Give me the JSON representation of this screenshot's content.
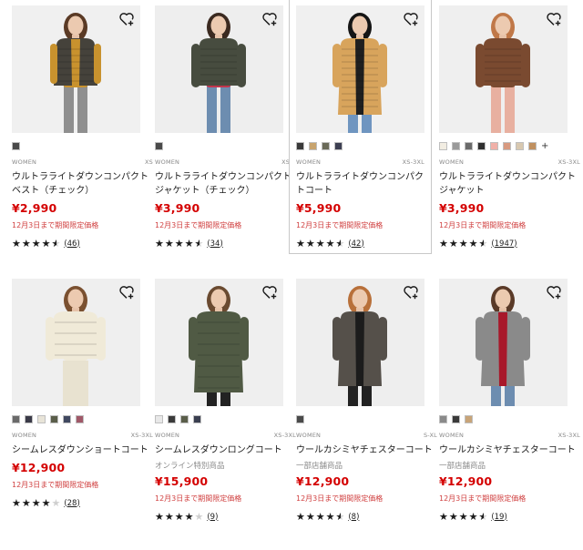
{
  "products": [
    {
      "category": "WOMEN",
      "sizes": "XS",
      "name": "ウルトラライトダウンコンパクトベスト（チェック）",
      "sub": "",
      "price": "¥2,990",
      "promo": "12月3日まで期間限定価格",
      "rating": 4.5,
      "reviews": "46",
      "swatches": [
        "#4a4a4a"
      ],
      "more_swatches": false,
      "figure": {
        "bg": "#f0f0f0",
        "garment": "#45423b",
        "inner": "#c8922e",
        "hair": "#5a3a25",
        "bottom": "#8f8f8f",
        "style": "vest"
      }
    },
    {
      "category": "WOMEN",
      "sizes": "XS-S",
      "name": "ウルトラライトダウンコンパクトジャケット（チェック）",
      "sub": "",
      "price": "¥3,990",
      "promo": "12月3日まで期間限定価格",
      "rating": 4.5,
      "reviews": "34",
      "swatches": [
        "#4a4a4a"
      ],
      "more_swatches": false,
      "figure": {
        "bg": "#eeeeee",
        "garment": "#474c3f",
        "inner": "#c2354c",
        "hair": "#3b2a20",
        "bottom": "#6d8db0",
        "style": "jacket"
      }
    },
    {
      "category": "WOMEN",
      "sizes": "XS-3XL",
      "name": "ウルトラライトダウンコンパクトコート",
      "sub": "",
      "price": "¥5,990",
      "promo": "12月3日まで期間限定価格",
      "rating": 4.5,
      "reviews": "42",
      "swatches": [
        "#3a3a3a",
        "#c8a46e",
        "#6a6a58",
        "#3d3f52"
      ],
      "more_swatches": false,
      "figure": {
        "bg": "#f0f0f0",
        "garment": "#d8a45c",
        "inner": "#1f1f1f",
        "hair": "#151515",
        "bottom": "#6f95c0",
        "style": "coat"
      }
    },
    {
      "category": "WOMEN",
      "sizes": "XS-3XL",
      "name": "ウルトラライトダウンコンパクトジャケット",
      "sub": "",
      "price": "¥3,990",
      "promo": "12月3日まで期間限定価格",
      "rating": 4.5,
      "reviews": "1947",
      "swatches": [
        "#f2ede2",
        "#9a9a9a",
        "#6a6a6a",
        "#2f2f2f",
        "#f0b0a8",
        "#d89a80",
        "#d8c8b0",
        "#c09060"
      ],
      "more_swatches": true,
      "figure": {
        "bg": "#efefef",
        "garment": "#7a4a30",
        "inner": "#7a4a30",
        "hair": "#c07848",
        "bottom": "#e8b0a0",
        "style": "jacket"
      }
    },
    {
      "category": "WOMEN",
      "sizes": "XS-3XL",
      "name": "シームレスダウンショートコート",
      "sub": "",
      "price": "¥12,900",
      "promo": "12月3日まで期間限定価格",
      "rating": 4.0,
      "reviews": "28",
      "swatches": [
        "#6a6a6a",
        "#3a3a48",
        "#e8e4d8",
        "#5a5e4a",
        "#404860",
        "#a05868"
      ],
      "more_swatches": false,
      "figure": {
        "bg": "#efefef",
        "garment": "#f0ead8",
        "inner": "#f0ead8",
        "hair": "#7a5030",
        "bottom": "#e8e2d0",
        "style": "puffer"
      }
    },
    {
      "category": "WOMEN",
      "sizes": "XS-3XL",
      "name": "シームレスダウンロングコート",
      "sub": "オンライン特別商品",
      "price": "¥15,900",
      "promo": "12月3日まで期間限定価格",
      "rating": 4.0,
      "reviews": "9",
      "swatches": [
        "#e8e8e8",
        "#3a3a3a",
        "#5a5e4a",
        "#3a3f50"
      ],
      "more_swatches": false,
      "figure": {
        "bg": "#efefef",
        "garment": "#505a44",
        "inner": "#505a44",
        "hair": "#6a4a30",
        "bottom": "#222222",
        "style": "longpuffer"
      }
    },
    {
      "category": "WOMEN",
      "sizes": "S-XL",
      "name": "ウールカシミヤチェスターコート",
      "sub": "一部店舗商品",
      "price": "¥12,900",
      "promo": "12月3日まで期間限定価格",
      "rating": 4.5,
      "reviews": "8",
      "swatches": [
        "#4a4a4a"
      ],
      "more_swatches": false,
      "figure": {
        "bg": "#eeeeee",
        "garment": "#55504a",
        "inner": "#1c1c1c",
        "hair": "#b8703a",
        "bottom": "#222222",
        "style": "chester"
      }
    },
    {
      "category": "WOMEN",
      "sizes": "XS-3XL",
      "name": "ウールカシミヤチェスターコート",
      "sub": "一部店舗商品",
      "price": "¥12,900",
      "promo": "12月3日まで期間限定価格",
      "rating": 4.5,
      "reviews": "19",
      "swatches": [
        "#8a8a8a",
        "#3a3a3a",
        "#c8a478"
      ],
      "more_swatches": false,
      "figure": {
        "bg": "#efefef",
        "garment": "#8a8a8a",
        "inner": "#a8182a",
        "hair": "#5a3a28",
        "bottom": "#6d8db0",
        "style": "chester"
      }
    }
  ],
  "more_swatches_label": "+"
}
